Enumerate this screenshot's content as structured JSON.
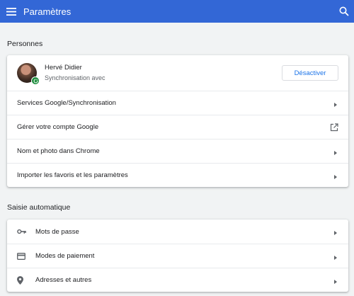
{
  "header": {
    "title": "Paramètres",
    "menu_icon": "hamburger-menu-icon",
    "search_icon": "search-icon",
    "bg_color": "#3367d6"
  },
  "people": {
    "section_title": "Personnes",
    "profile": {
      "name": "Hervé Didier",
      "status": "Synchronisation avec",
      "deactivate_label": "Désactiver"
    },
    "items": [
      {
        "label": "Services Google/Synchronisation",
        "icon": "arrow-right-icon"
      },
      {
        "label": "Gérer votre compte Google",
        "icon": "open-external-icon"
      },
      {
        "label": "Nom et photo dans Chrome",
        "icon": "arrow-right-icon"
      },
      {
        "label": "Importer les favoris et les paramètres",
        "icon": "arrow-right-icon"
      }
    ]
  },
  "autofill": {
    "section_title": "Saisie automatique",
    "items": [
      {
        "label": "Mots de passe",
        "icon": "key-icon"
      },
      {
        "label": "Modes de paiement",
        "icon": "credit-card-icon"
      },
      {
        "label": "Adresses et autres",
        "icon": "location-pin-icon"
      }
    ]
  }
}
